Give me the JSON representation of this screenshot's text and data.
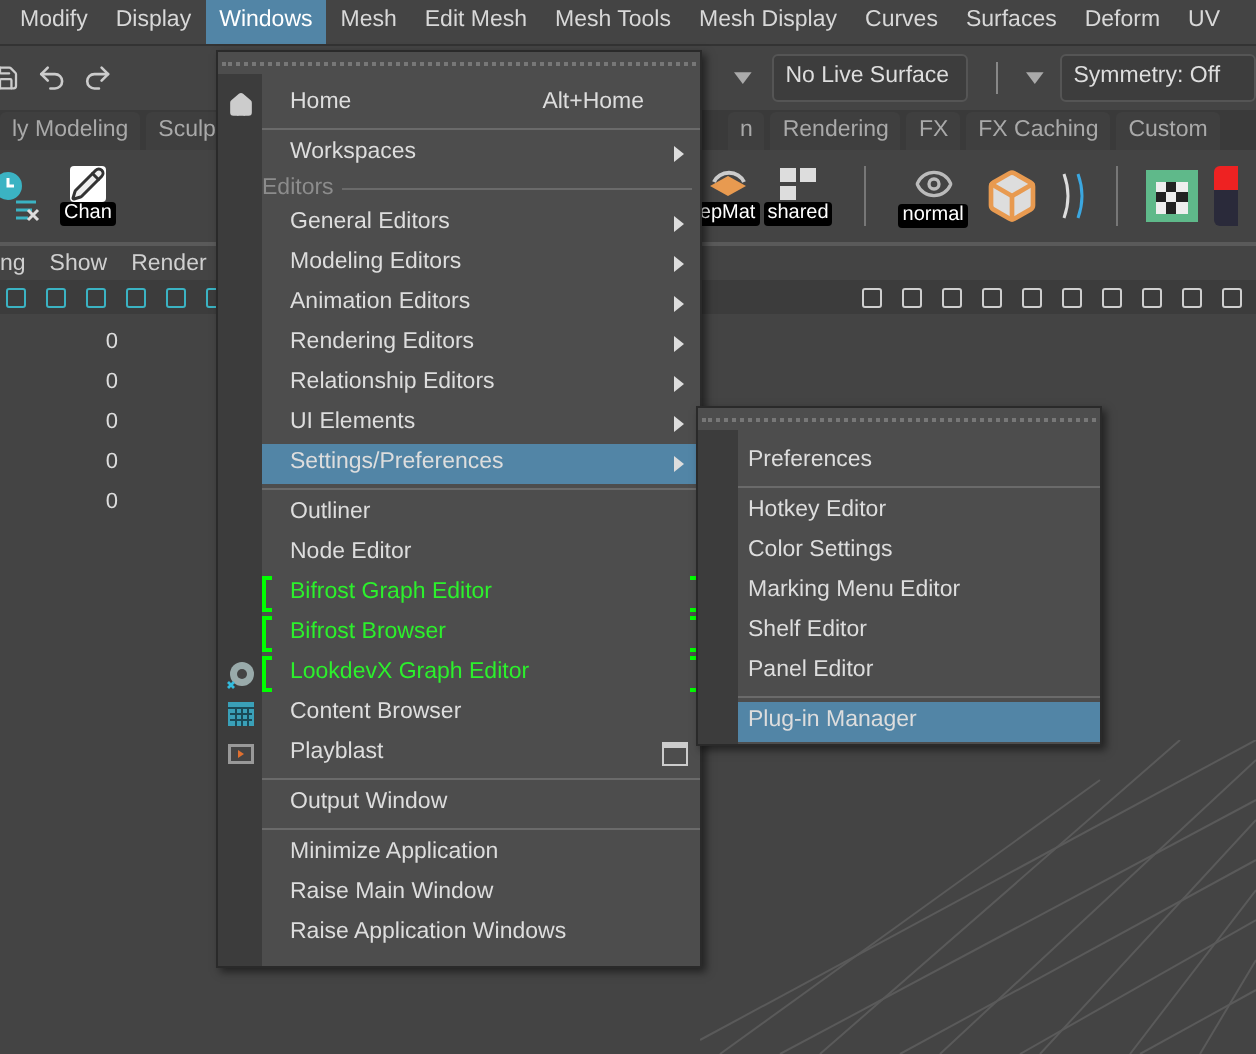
{
  "menubar": [
    {
      "label": "Modify",
      "selected": false
    },
    {
      "label": "Display",
      "selected": false
    },
    {
      "label": "Windows",
      "selected": true
    },
    {
      "label": "Mesh",
      "selected": false
    },
    {
      "label": "Edit Mesh",
      "selected": false
    },
    {
      "label": "Mesh Tools",
      "selected": false
    },
    {
      "label": "Mesh Display",
      "selected": false
    },
    {
      "label": "Curves",
      "selected": false
    },
    {
      "label": "Surfaces",
      "selected": false
    },
    {
      "label": "Deform",
      "selected": false
    },
    {
      "label": "UV",
      "selected": false
    }
  ],
  "status_line": {
    "live_surface": "No Live Surface",
    "symmetry": "Symmetry: Off"
  },
  "shelf_tabs_left": [
    {
      "label": "ly Modeling",
      "selected": false
    },
    {
      "label": "Sculp",
      "selected": false
    }
  ],
  "shelf_tabs_right": [
    {
      "label": "n",
      "selected": false
    },
    {
      "label": "Rendering",
      "selected": false
    },
    {
      "label": "FX",
      "selected": false
    },
    {
      "label": "FX Caching",
      "selected": false
    },
    {
      "label": "Custom",
      "selected": false
    }
  ],
  "shelf_labels": [
    "Chan",
    "epMat",
    "shared",
    "normal"
  ],
  "panel_menu": [
    "ng",
    "Show",
    "Render"
  ],
  "channel_values": [
    "0",
    "0",
    "0",
    "0",
    "0"
  ],
  "windows_menu": [
    {
      "kind": "item",
      "label": "Home",
      "shortcut": "Alt+Home",
      "has_icon": true,
      "submenu": false,
      "option_box": false,
      "plugin": false,
      "selected": false
    },
    {
      "kind": "separator"
    },
    {
      "kind": "item",
      "label": "Workspaces",
      "has_icon": false,
      "submenu": true,
      "option_box": false,
      "plugin": false,
      "selected": false
    },
    {
      "kind": "header",
      "label": "Editors"
    },
    {
      "kind": "item",
      "label": "General Editors",
      "has_icon": false,
      "submenu": true,
      "option_box": false,
      "plugin": false,
      "selected": false
    },
    {
      "kind": "item",
      "label": "Modeling Editors",
      "has_icon": false,
      "submenu": true,
      "option_box": false,
      "plugin": false,
      "selected": false
    },
    {
      "kind": "item",
      "label": "Animation Editors",
      "has_icon": false,
      "submenu": true,
      "option_box": false,
      "plugin": false,
      "selected": false
    },
    {
      "kind": "item",
      "label": "Rendering Editors",
      "has_icon": false,
      "submenu": true,
      "option_box": false,
      "plugin": false,
      "selected": false
    },
    {
      "kind": "item",
      "label": "Relationship Editors",
      "has_icon": false,
      "submenu": true,
      "option_box": false,
      "plugin": false,
      "selected": false
    },
    {
      "kind": "item",
      "label": "UI Elements",
      "has_icon": false,
      "submenu": true,
      "option_box": false,
      "plugin": false,
      "selected": false
    },
    {
      "kind": "item",
      "label": "Settings/Preferences",
      "has_icon": false,
      "submenu": true,
      "option_box": false,
      "plugin": false,
      "selected": true
    },
    {
      "kind": "separator"
    },
    {
      "kind": "item",
      "label": "Outliner",
      "has_icon": false,
      "submenu": false,
      "option_box": false,
      "plugin": false,
      "selected": false
    },
    {
      "kind": "item",
      "label": "Node Editor",
      "has_icon": false,
      "submenu": false,
      "option_box": false,
      "plugin": false,
      "selected": false
    },
    {
      "kind": "item",
      "label": "Bifrost Graph Editor",
      "has_icon": false,
      "submenu": false,
      "option_box": false,
      "plugin": true,
      "selected": false
    },
    {
      "kind": "item",
      "label": "Bifrost Browser",
      "has_icon": false,
      "submenu": false,
      "option_box": false,
      "plugin": true,
      "selected": false
    },
    {
      "kind": "item",
      "label": "LookdevX Graph Editor",
      "has_icon": true,
      "submenu": false,
      "option_box": false,
      "plugin": true,
      "selected": false
    },
    {
      "kind": "item",
      "label": "Content Browser",
      "has_icon": true,
      "submenu": false,
      "option_box": false,
      "plugin": false,
      "selected": false
    },
    {
      "kind": "item",
      "label": "Playblast",
      "has_icon": true,
      "submenu": false,
      "option_box": true,
      "plugin": false,
      "selected": false
    },
    {
      "kind": "separator"
    },
    {
      "kind": "item",
      "label": "Output Window",
      "has_icon": false,
      "submenu": false,
      "option_box": false,
      "plugin": false,
      "selected": false
    },
    {
      "kind": "separator"
    },
    {
      "kind": "item",
      "label": "Minimize Application",
      "has_icon": false,
      "submenu": false,
      "option_box": false,
      "plugin": false,
      "selected": false
    },
    {
      "kind": "item",
      "label": "Raise Main Window",
      "has_icon": false,
      "submenu": false,
      "option_box": false,
      "plugin": false,
      "selected": false
    },
    {
      "kind": "item",
      "label": "Raise Application Windows",
      "has_icon": false,
      "submenu": false,
      "option_box": false,
      "plugin": false,
      "selected": false
    }
  ],
  "settings_submenu": [
    {
      "kind": "item",
      "label": "Preferences",
      "selected": false
    },
    {
      "kind": "separator"
    },
    {
      "kind": "item",
      "label": "Hotkey Editor",
      "selected": false
    },
    {
      "kind": "item",
      "label": "Color Settings",
      "selected": false
    },
    {
      "kind": "item",
      "label": "Marking Menu Editor",
      "selected": false
    },
    {
      "kind": "item",
      "label": "Shelf Editor",
      "selected": false
    },
    {
      "kind": "item",
      "label": "Panel Editor",
      "selected": false
    },
    {
      "kind": "separator"
    },
    {
      "kind": "item",
      "label": "Plug-in Manager",
      "selected": true
    }
  ]
}
